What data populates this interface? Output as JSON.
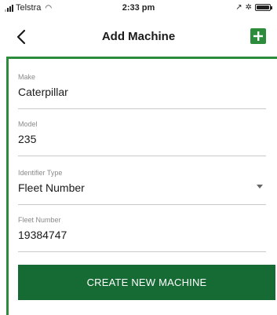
{
  "status_bar": {
    "carrier": "Telstra",
    "time": "2:33 pm",
    "icons": [
      "signal-icon",
      "wifi-icon",
      "location-icon",
      "bluetooth-icon",
      "battery-icon"
    ]
  },
  "nav": {
    "title": "Add Machine",
    "back_icon": "chevron-left-icon",
    "add_icon": "plus-icon"
  },
  "form": {
    "make": {
      "label": "Make",
      "value": "Caterpillar"
    },
    "model": {
      "label": "Model",
      "value": "235"
    },
    "identifier_type": {
      "label": "Identifier Type",
      "value": "Fleet Number"
    },
    "fleet_number": {
      "label": "Fleet Number",
      "value": "19384747"
    },
    "submit_label": "CREATE NEW MACHINE"
  },
  "colors": {
    "accent": "#2c8c3c",
    "button": "#166a34"
  }
}
